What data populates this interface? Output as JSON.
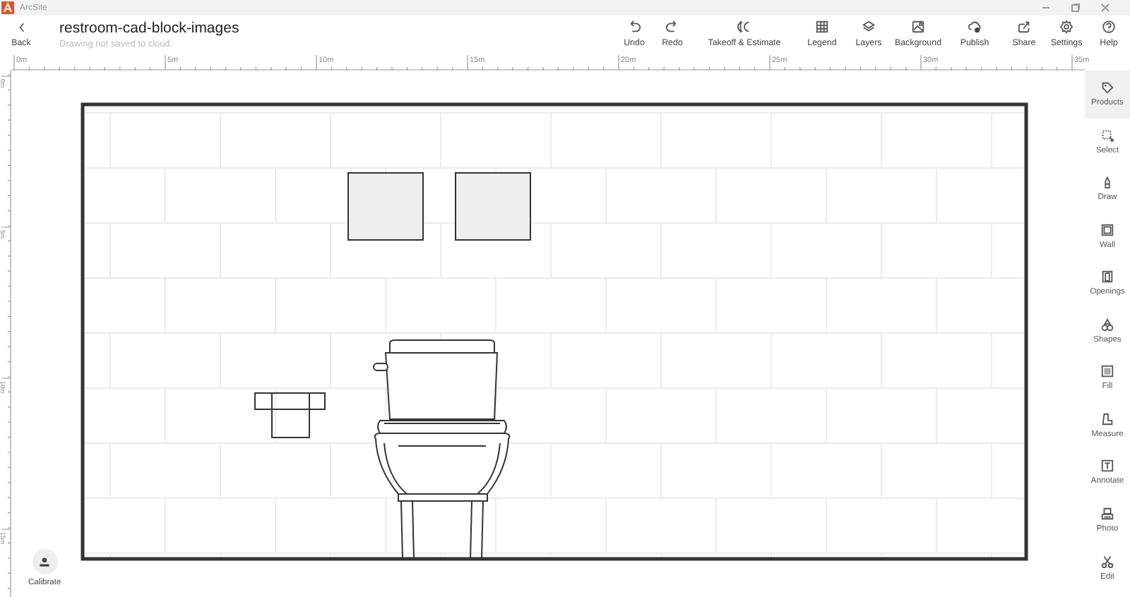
{
  "window": {
    "title": "ArcSite"
  },
  "header": {
    "back": "Back",
    "title": "restroom-cad-block-images",
    "subtitle": "Drawing not saved to cloud."
  },
  "toolbar": [
    {
      "label": "Undo"
    },
    {
      "label": "Redo"
    },
    {
      "label": "Takeoff & Estimate"
    },
    {
      "label": "Legend"
    },
    {
      "label": "Layers"
    },
    {
      "label": "Background"
    },
    {
      "label": "Publish"
    },
    {
      "label": "Share"
    },
    {
      "label": "Settings"
    },
    {
      "label": "Help"
    }
  ],
  "ruler": {
    "horizontal": [
      "0m",
      "5m",
      "10m",
      "15m",
      "20m",
      "25m",
      "30m",
      "35m"
    ],
    "vertical": [
      "0m",
      "5m",
      "10m",
      "15m"
    ]
  },
  "tools": [
    {
      "label": "Products",
      "selected": true
    },
    {
      "label": "Select",
      "selected": false
    },
    {
      "label": "Draw",
      "selected": false
    },
    {
      "label": "Wall",
      "selected": false
    },
    {
      "label": "Openings",
      "selected": false
    },
    {
      "label": "Shapes",
      "selected": false
    },
    {
      "label": "Fill",
      "selected": false
    },
    {
      "label": "Measure",
      "selected": false
    },
    {
      "label": "Annotate",
      "selected": false
    },
    {
      "label": "Photo",
      "selected": false
    },
    {
      "label": "Edit",
      "selected": false
    }
  ],
  "calibrate": "Calibrate"
}
